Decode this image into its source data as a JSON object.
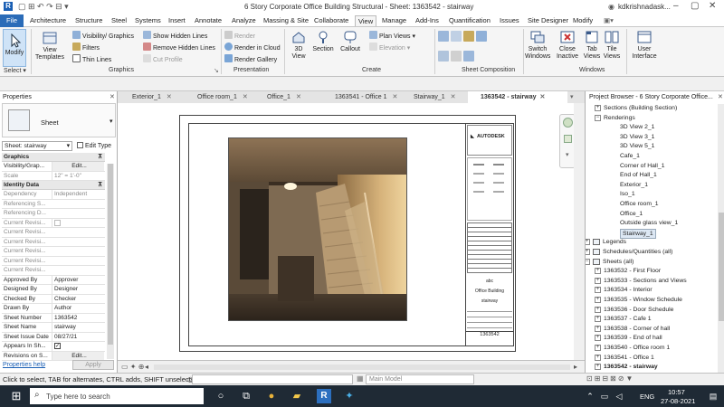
{
  "window": {
    "title": "6 Story Corporate Office Building Structural - Sheet: 1363542 - stairway",
    "user": "kdkrishnadask..."
  },
  "ribbon_tabs": [
    "File",
    "Architecture",
    "Structure",
    "Steel",
    "Systems",
    "Insert",
    "Annotate",
    "Analyze",
    "Massing & Site",
    "Collaborate",
    "View",
    "Manage",
    "Add-Ins",
    "Quantification",
    "Issues",
    "Site Designer",
    "Modify"
  ],
  "ribbon": {
    "modify": "Modify",
    "select": "Select ▾",
    "view_templates": "View Templates",
    "visibility": "Visibility/ Graphics",
    "filters": "Filters",
    "thin_lines": "Thin Lines",
    "show_hidden": "Show Hidden Lines",
    "remove_hidden": "Remove Hidden Lines",
    "cut_profile": "Cut Profile",
    "graphics_label": "Graphics",
    "render": "Render",
    "render_cloud": "Render in Cloud",
    "render_gallery": "Render Gallery",
    "presentation_label": "Presentation",
    "view3d": "3D View",
    "section": "Section",
    "callout": "Callout",
    "plan_views": "Plan Views ▾",
    "elevation": "Elevation ▾",
    "create_label": "Create",
    "sheet_comp_label": "Sheet Composition",
    "switch_windows": "Switch Windows",
    "close_inactive": "Close Inactive",
    "tab_views": "Tab Views",
    "tile_views": "Tile Views",
    "windows_label": "Windows",
    "user_interface": "User Interface"
  },
  "properties": {
    "title": "Properties",
    "type": "Sheet",
    "selector": "Sheet: stairway",
    "edit_type": "Edit Type",
    "graphics_section": "Graphics",
    "rows_graphics": [
      {
        "k": "Visibility/Grap...",
        "v": "Edit..."
      },
      {
        "k": "Scale",
        "v": "12\" = 1'-0\""
      }
    ],
    "identity_section": "Identity Data",
    "rows_identity": [
      {
        "k": "Dependency",
        "v": "Independent"
      },
      {
        "k": "Referencing S...",
        "v": ""
      },
      {
        "k": "Referencing D...",
        "v": ""
      },
      {
        "k": "Current Revisi...",
        "v": ""
      },
      {
        "k": "Current Revisi...",
        "v": ""
      },
      {
        "k": "Current Revisi...",
        "v": ""
      },
      {
        "k": "Current Revisi...",
        "v": ""
      },
      {
        "k": "Current Revisi...",
        "v": ""
      },
      {
        "k": "Current Revisi...",
        "v": ""
      },
      {
        "k": "Approved By",
        "v": "Approver"
      },
      {
        "k": "Designed By",
        "v": "Designer"
      },
      {
        "k": "Checked By",
        "v": "Checker"
      },
      {
        "k": "Drawn By",
        "v": "Author"
      },
      {
        "k": "Sheet Number",
        "v": "1363542"
      },
      {
        "k": "Sheet Name",
        "v": "stairway"
      },
      {
        "k": "Sheet Issue Date",
        "v": "08/27/21"
      },
      {
        "k": "Appears In Sh...",
        "v": ""
      },
      {
        "k": "Revisions on S...",
        "v": "Edit..."
      }
    ],
    "help": "Properties help",
    "apply": "Apply"
  },
  "doc_tabs": [
    "Exterior_1",
    "Office room_1",
    "Office_1",
    "1363541 - Office 1",
    "Stairway_1",
    "1363542 - stairway"
  ],
  "sheet": {
    "brand": "AUTODESK",
    "abc": "abc",
    "project": "Office Building",
    "name": "stairway",
    "number": "1363542"
  },
  "project_browser": {
    "title": "Project Browser - 6 Story Corporate Office...",
    "items": [
      {
        "t": "Sections (Building Section)",
        "lvl": 1,
        "box": "+"
      },
      {
        "t": "Renderings",
        "lvl": 1,
        "box": "−"
      },
      {
        "t": "3D View 2_1",
        "lvl": 2
      },
      {
        "t": "3D View 3_1",
        "lvl": 2
      },
      {
        "t": "3D View 5_1",
        "lvl": 2
      },
      {
        "t": "Cafe_1",
        "lvl": 2
      },
      {
        "t": "Corner of Hall_1",
        "lvl": 2
      },
      {
        "t": "End of Hall_1",
        "lvl": 2
      },
      {
        "t": "Exterior_1",
        "lvl": 2
      },
      {
        "t": "Iso_1",
        "lvl": 2
      },
      {
        "t": "Office room_1",
        "lvl": 2
      },
      {
        "t": "Office_1",
        "lvl": 2
      },
      {
        "t": "Outside glass view_1",
        "lvl": 2
      },
      {
        "t": "Stairway_1",
        "lvl": 2,
        "sel": true
      },
      {
        "t": "Legends",
        "lvl": 0,
        "box": "+",
        "icon": true
      },
      {
        "t": "Schedules/Quantities (all)",
        "lvl": 0,
        "box": "+",
        "icon": true
      },
      {
        "t": "Sheets (all)",
        "lvl": 0,
        "box": "−",
        "icon": true
      },
      {
        "t": "1363532 - First Floor",
        "lvl": 1,
        "box": "+"
      },
      {
        "t": "1363533 - Sections and Views",
        "lvl": 1,
        "box": "+"
      },
      {
        "t": "1363534 - Interior",
        "lvl": 1,
        "box": "+"
      },
      {
        "t": "1363535 - Window Schedule",
        "lvl": 1,
        "box": "+"
      },
      {
        "t": "1363536 - Door Schedule",
        "lvl": 1,
        "box": "+"
      },
      {
        "t": "1363537 - Cafe 1",
        "lvl": 1,
        "box": "+"
      },
      {
        "t": "1363538 - Corner of hall",
        "lvl": 1,
        "box": "+"
      },
      {
        "t": "1363539 - End of hall",
        "lvl": 1,
        "box": "+"
      },
      {
        "t": "1363540 - Office room 1",
        "lvl": 1,
        "box": "+"
      },
      {
        "t": "1363541 - Office 1",
        "lvl": 1,
        "box": "+"
      },
      {
        "t": "1363542 - stairway",
        "lvl": 1,
        "box": "+",
        "bold": true
      }
    ]
  },
  "status": {
    "message": "Click to select, TAB for alternates, CTRL adds, SHIFT unselects.",
    "model": "Main Model",
    "zero": ":0"
  },
  "taskbar": {
    "search": "Type here to search",
    "lang": "ENG",
    "time": "10:57",
    "date": "27-08-2021"
  }
}
